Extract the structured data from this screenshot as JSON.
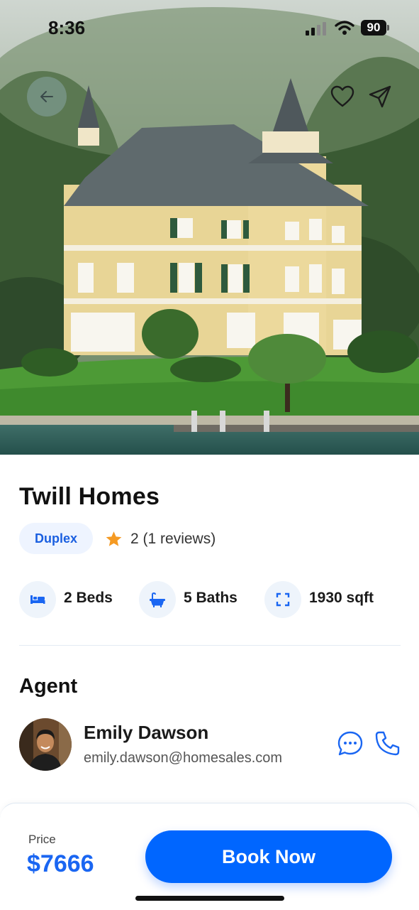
{
  "status_bar": {
    "time": "8:36",
    "battery": "90"
  },
  "property": {
    "name": "Twill Homes",
    "type_badge": "Duplex",
    "rating_text": "2 (1 reviews)",
    "features": [
      {
        "icon": "bed-icon",
        "label": "2 Beds"
      },
      {
        "icon": "bathtub-icon",
        "label": "5 Baths"
      },
      {
        "icon": "area-expand-icon",
        "label": "1930 sqft"
      }
    ]
  },
  "agent": {
    "heading": "Agent",
    "name": "Emily Dawson",
    "email": "emily.dawson@homesales.com"
  },
  "footer": {
    "price_label": "Price",
    "price": "$7666",
    "book_label": "Book Now"
  },
  "colors": {
    "accent": "#0066FF",
    "badge_bg": "#EEF4FF",
    "star": "#F59A23"
  }
}
